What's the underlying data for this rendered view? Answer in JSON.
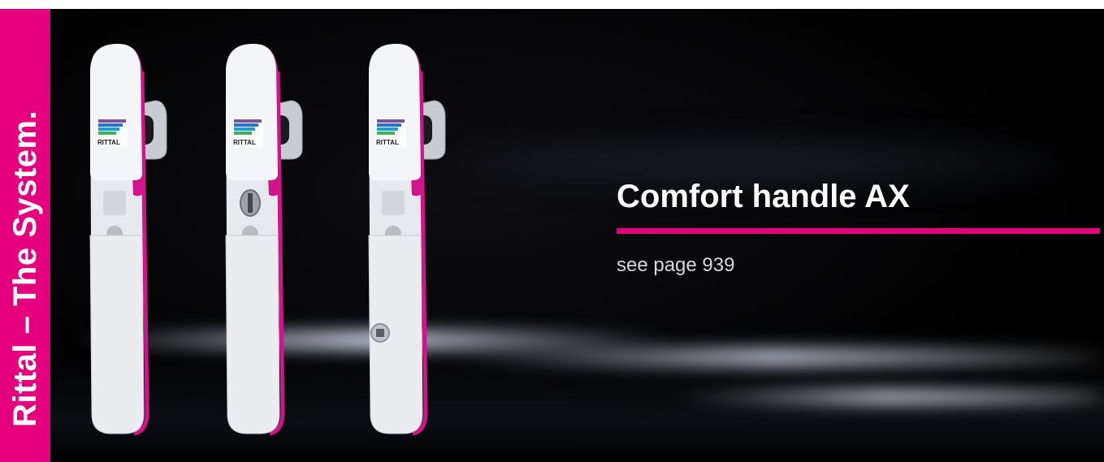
{
  "brand": {
    "tagline": "Rittal – The System.",
    "logo_text": "RITTAL"
  },
  "product": {
    "title": "Comfort handle AX",
    "page_reference": "see page 939"
  },
  "colors": {
    "brand_magenta": "#e5007d",
    "background": "#000000",
    "handle_body": "#e8e9ee",
    "headline_text": "#ffffff",
    "subline_text": "#d8d8dc"
  },
  "variants": [
    {
      "insert": "blank"
    },
    {
      "insert": "key-cylinder"
    },
    {
      "insert": "square-socket"
    }
  ]
}
